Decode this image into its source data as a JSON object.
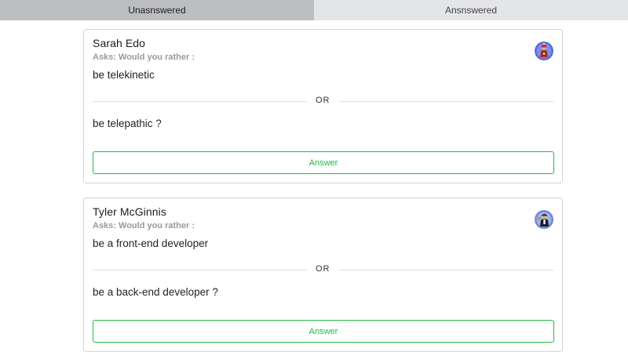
{
  "tabs": [
    {
      "label": "Unasnswered",
      "active": true
    },
    {
      "label": "Ansnswered",
      "active": false
    }
  ],
  "questions": [
    {
      "author": "Sarah Edo",
      "asks": "Asks: Would you rather :",
      "option_one": "be telekinetic",
      "or_label": "OR",
      "option_two": "be telepathic ?",
      "button_label": "Answer",
      "avatar_icon": "user-avatar-icon"
    },
    {
      "author": "Tyler McGinnis",
      "asks": "Asks: Would you rather :",
      "option_one": "be a front-end developer",
      "or_label": "OR",
      "option_two": "be a back-end developer ?",
      "button_label": "Answer",
      "avatar_icon": "user-avatar-icon"
    }
  ],
  "colors": {
    "accent_green": "#21ba45",
    "tab_active": "#bdbec0",
    "tab_inactive": "#e4e5e7"
  }
}
